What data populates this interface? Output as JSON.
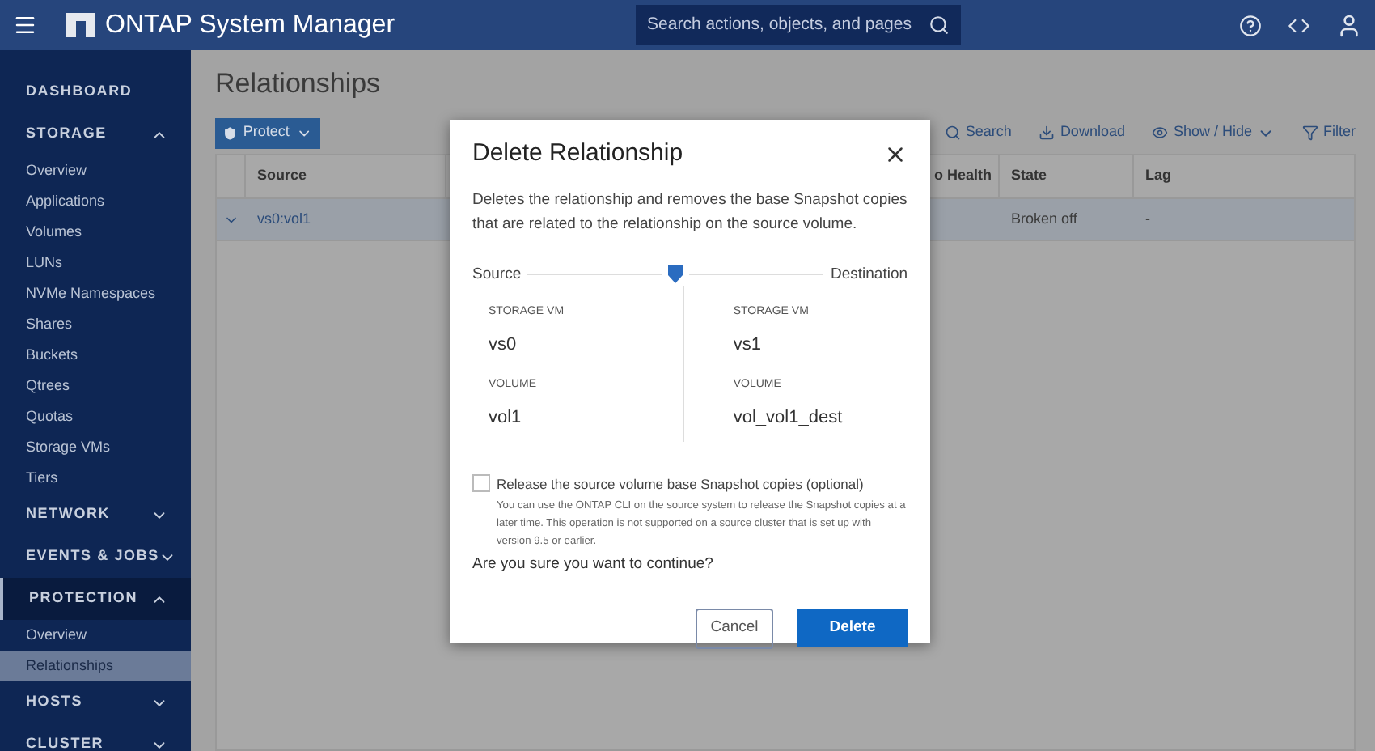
{
  "header": {
    "title": "ONTAP System Manager",
    "search": {
      "placeholder": "Search actions, objects, and pages"
    }
  },
  "sidebar": {
    "sections": [
      {
        "label": "DASHBOARD",
        "selected": false
      },
      {
        "label": "STORAGE",
        "expanded": true,
        "selected": false,
        "items": [
          {
            "label": "Overview",
            "selected": false
          },
          {
            "label": "Applications",
            "selected": false
          },
          {
            "label": "Volumes",
            "selected": false
          },
          {
            "label": "LUNs",
            "selected": false
          },
          {
            "label": "NVMe Namespaces",
            "selected": false
          },
          {
            "label": "Shares",
            "selected": false
          },
          {
            "label": "Buckets",
            "selected": false
          },
          {
            "label": "Qtrees",
            "selected": false
          },
          {
            "label": "Quotas",
            "selected": false
          },
          {
            "label": "Storage VMs",
            "selected": false
          },
          {
            "label": "Tiers",
            "selected": false
          }
        ]
      },
      {
        "label": "NETWORK",
        "expanded": false,
        "selected": false
      },
      {
        "label": "EVENTS & JOBS",
        "expanded": false,
        "selected": false
      },
      {
        "label": "PROTECTION",
        "expanded": true,
        "selected": true,
        "items": [
          {
            "label": "Overview",
            "selected": false
          },
          {
            "label": "Relationships",
            "selected": true
          }
        ]
      },
      {
        "label": "HOSTS",
        "expanded": false,
        "selected": false
      },
      {
        "label": "CLUSTER",
        "expanded": false,
        "selected": false
      }
    ]
  },
  "page": {
    "title": "Relationships",
    "protect_button": "Protect",
    "toolbar": [
      {
        "kind": "search",
        "label": "Search"
      },
      {
        "kind": "download",
        "label": "Download"
      },
      {
        "kind": "showhide",
        "label": "Show / Hide"
      },
      {
        "kind": "filter",
        "label": "Filter"
      }
    ],
    "table": {
      "columns": [
        "Source",
        "o Health",
        "State",
        "Lag"
      ],
      "rows": [
        {
          "expanded": false,
          "source": "vs0:vol1",
          "state": "Broken off",
          "lag": "-"
        }
      ]
    }
  },
  "dialog": {
    "title": "Delete Relationship",
    "description": "Deletes the relationship and removes the base Snapshot copies that are related to the relationship on the source volume.",
    "source_label": "Source",
    "destination_label": "Destination",
    "source": [
      {
        "label": "STORAGE VM",
        "value": "vs0"
      },
      {
        "label": "VOLUME",
        "value": "vol1"
      }
    ],
    "destination": [
      {
        "label": "STORAGE VM",
        "value": "vs1"
      },
      {
        "label": "VOLUME",
        "value": "vol_vol1_dest"
      }
    ],
    "release": {
      "label": "Release the source volume base Snapshot copies (optional)",
      "checked": false,
      "help": "You can use the ONTAP CLI on the source system to release the Snapshot copies at a later time. This operation is not supported on a source cluster that is set up with version 9.5 or earlier."
    },
    "question": "Are you sure you want to continue?",
    "cancel": "Cancel",
    "confirm": "Delete"
  }
}
